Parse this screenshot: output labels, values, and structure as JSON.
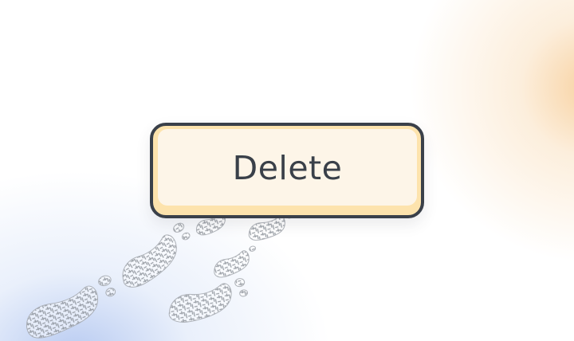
{
  "button": {
    "label": "Delete",
    "colors": {
      "border": "#3a4049",
      "face": "#fdf5e8",
      "base": "#fde3ad",
      "text": "#3a4049"
    }
  },
  "background": {
    "decoration": "footprints-pattern",
    "accent_colors": [
      "#f3b464",
      "#7ea0e6"
    ]
  }
}
